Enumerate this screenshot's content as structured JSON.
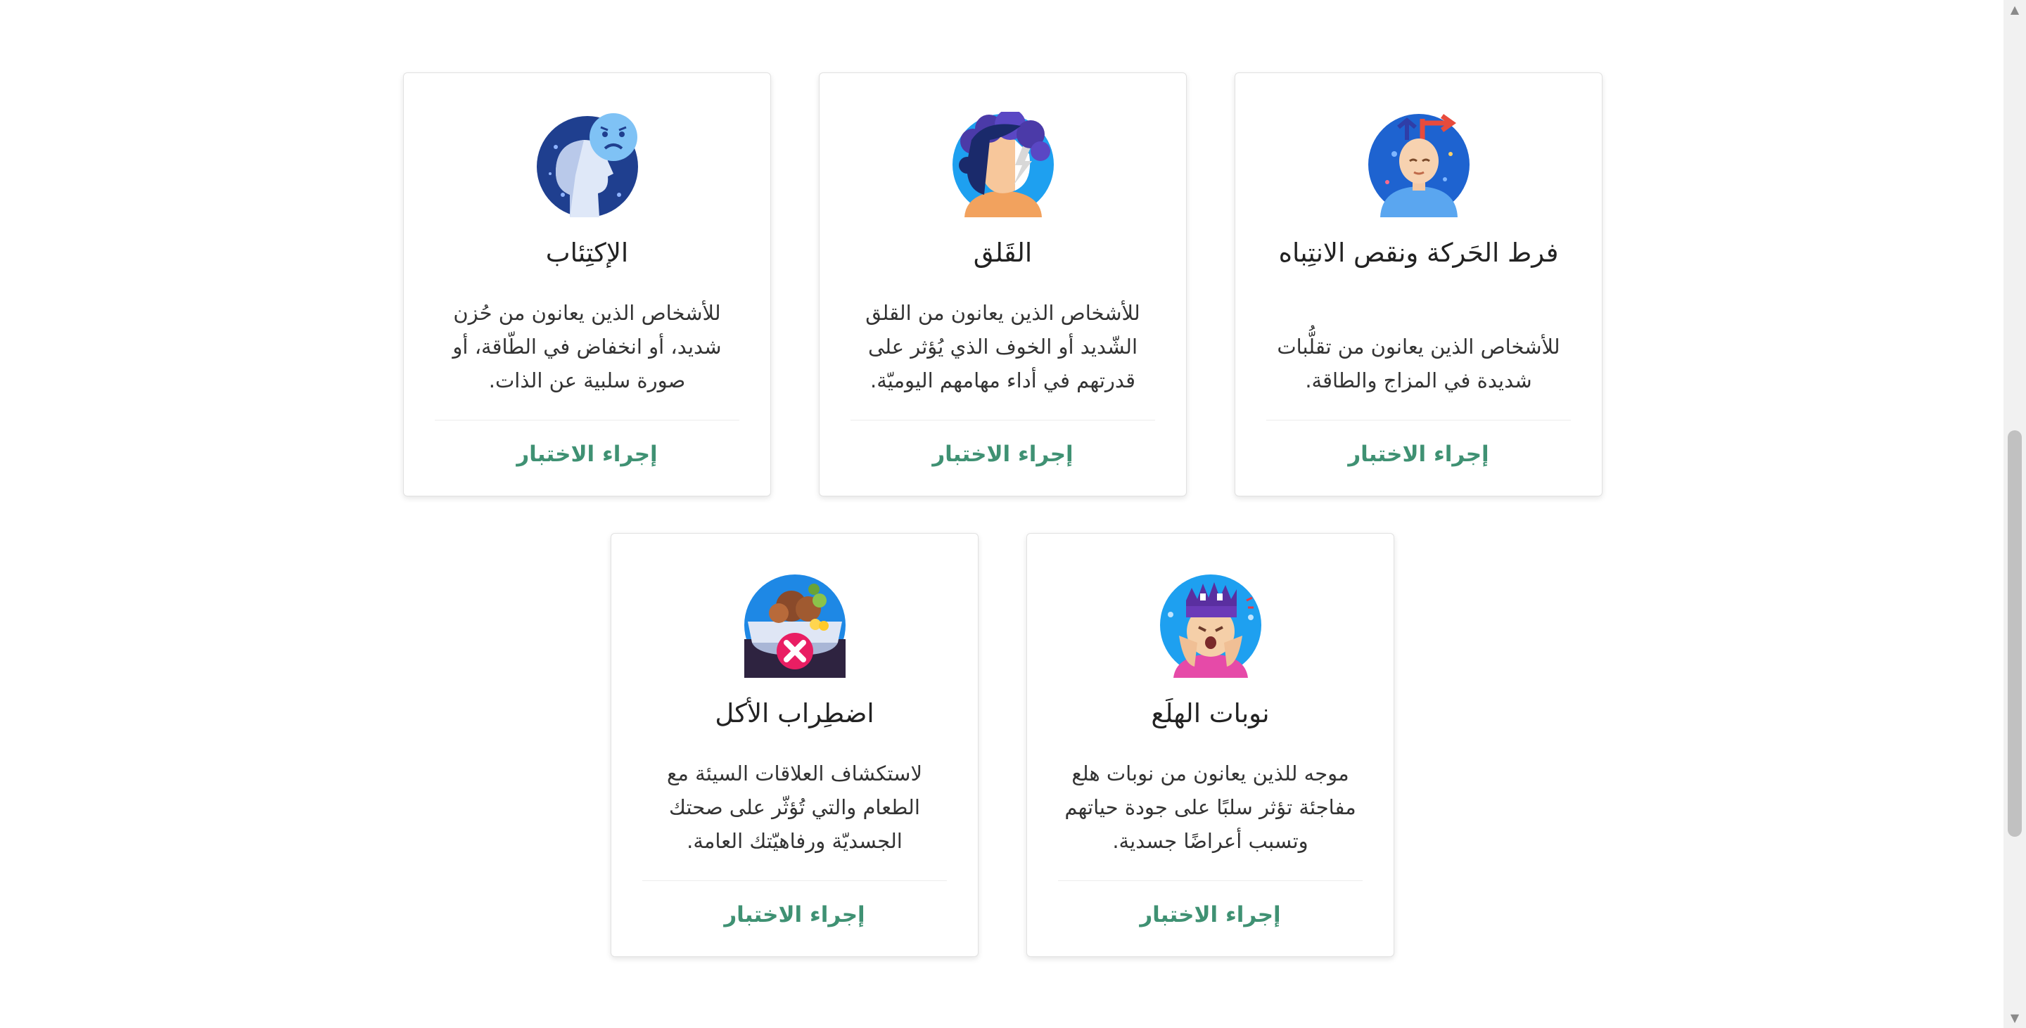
{
  "cards": [
    {
      "title": "فرط الحَركة ونقص الانتِباه",
      "desc": "للأشخاص الذين يعانون من تقلُّبات شديدة في المزاج والطاقة.",
      "cta": "إجراء الاختبار",
      "icon": "person-mind-arrows-icon"
    },
    {
      "title": "القَلق",
      "desc": "للأشخاص الذين يعانون من القلق الشّديد أو الخوف الذي يُؤثر على قدرتهم في أداء مهامهم اليوميّة.",
      "cta": "إجراء الاختبار",
      "icon": "head-lightning-cloud-icon"
    },
    {
      "title": "الإكتِئاب",
      "desc": "للأشخاص الذين يعانون من حُزن شديد، أو انخفاض في الطّاقة، أو صورة سلبية عن الذات.",
      "cta": "إجراء الاختبار",
      "icon": "sad-head-icon"
    },
    {
      "title": "نوبات الهلَع",
      "desc": "موجه للذين يعانون من نوبات هلع مفاجئة تؤثر سلبًا على جودة حياتهم وتسبب أعراضًا جسدية.",
      "cta": "إجراء الاختبار",
      "icon": "panic-face-icon"
    },
    {
      "title": "اضطِراب الأكل",
      "desc": "لاستكشاف العلاقات السيئة مع الطعام والتي تُؤثّر على صحتك الجسديّة ورفاهيّتك العامة.",
      "cta": "إجراء الاختبار",
      "icon": "food-cross-icon"
    }
  ]
}
